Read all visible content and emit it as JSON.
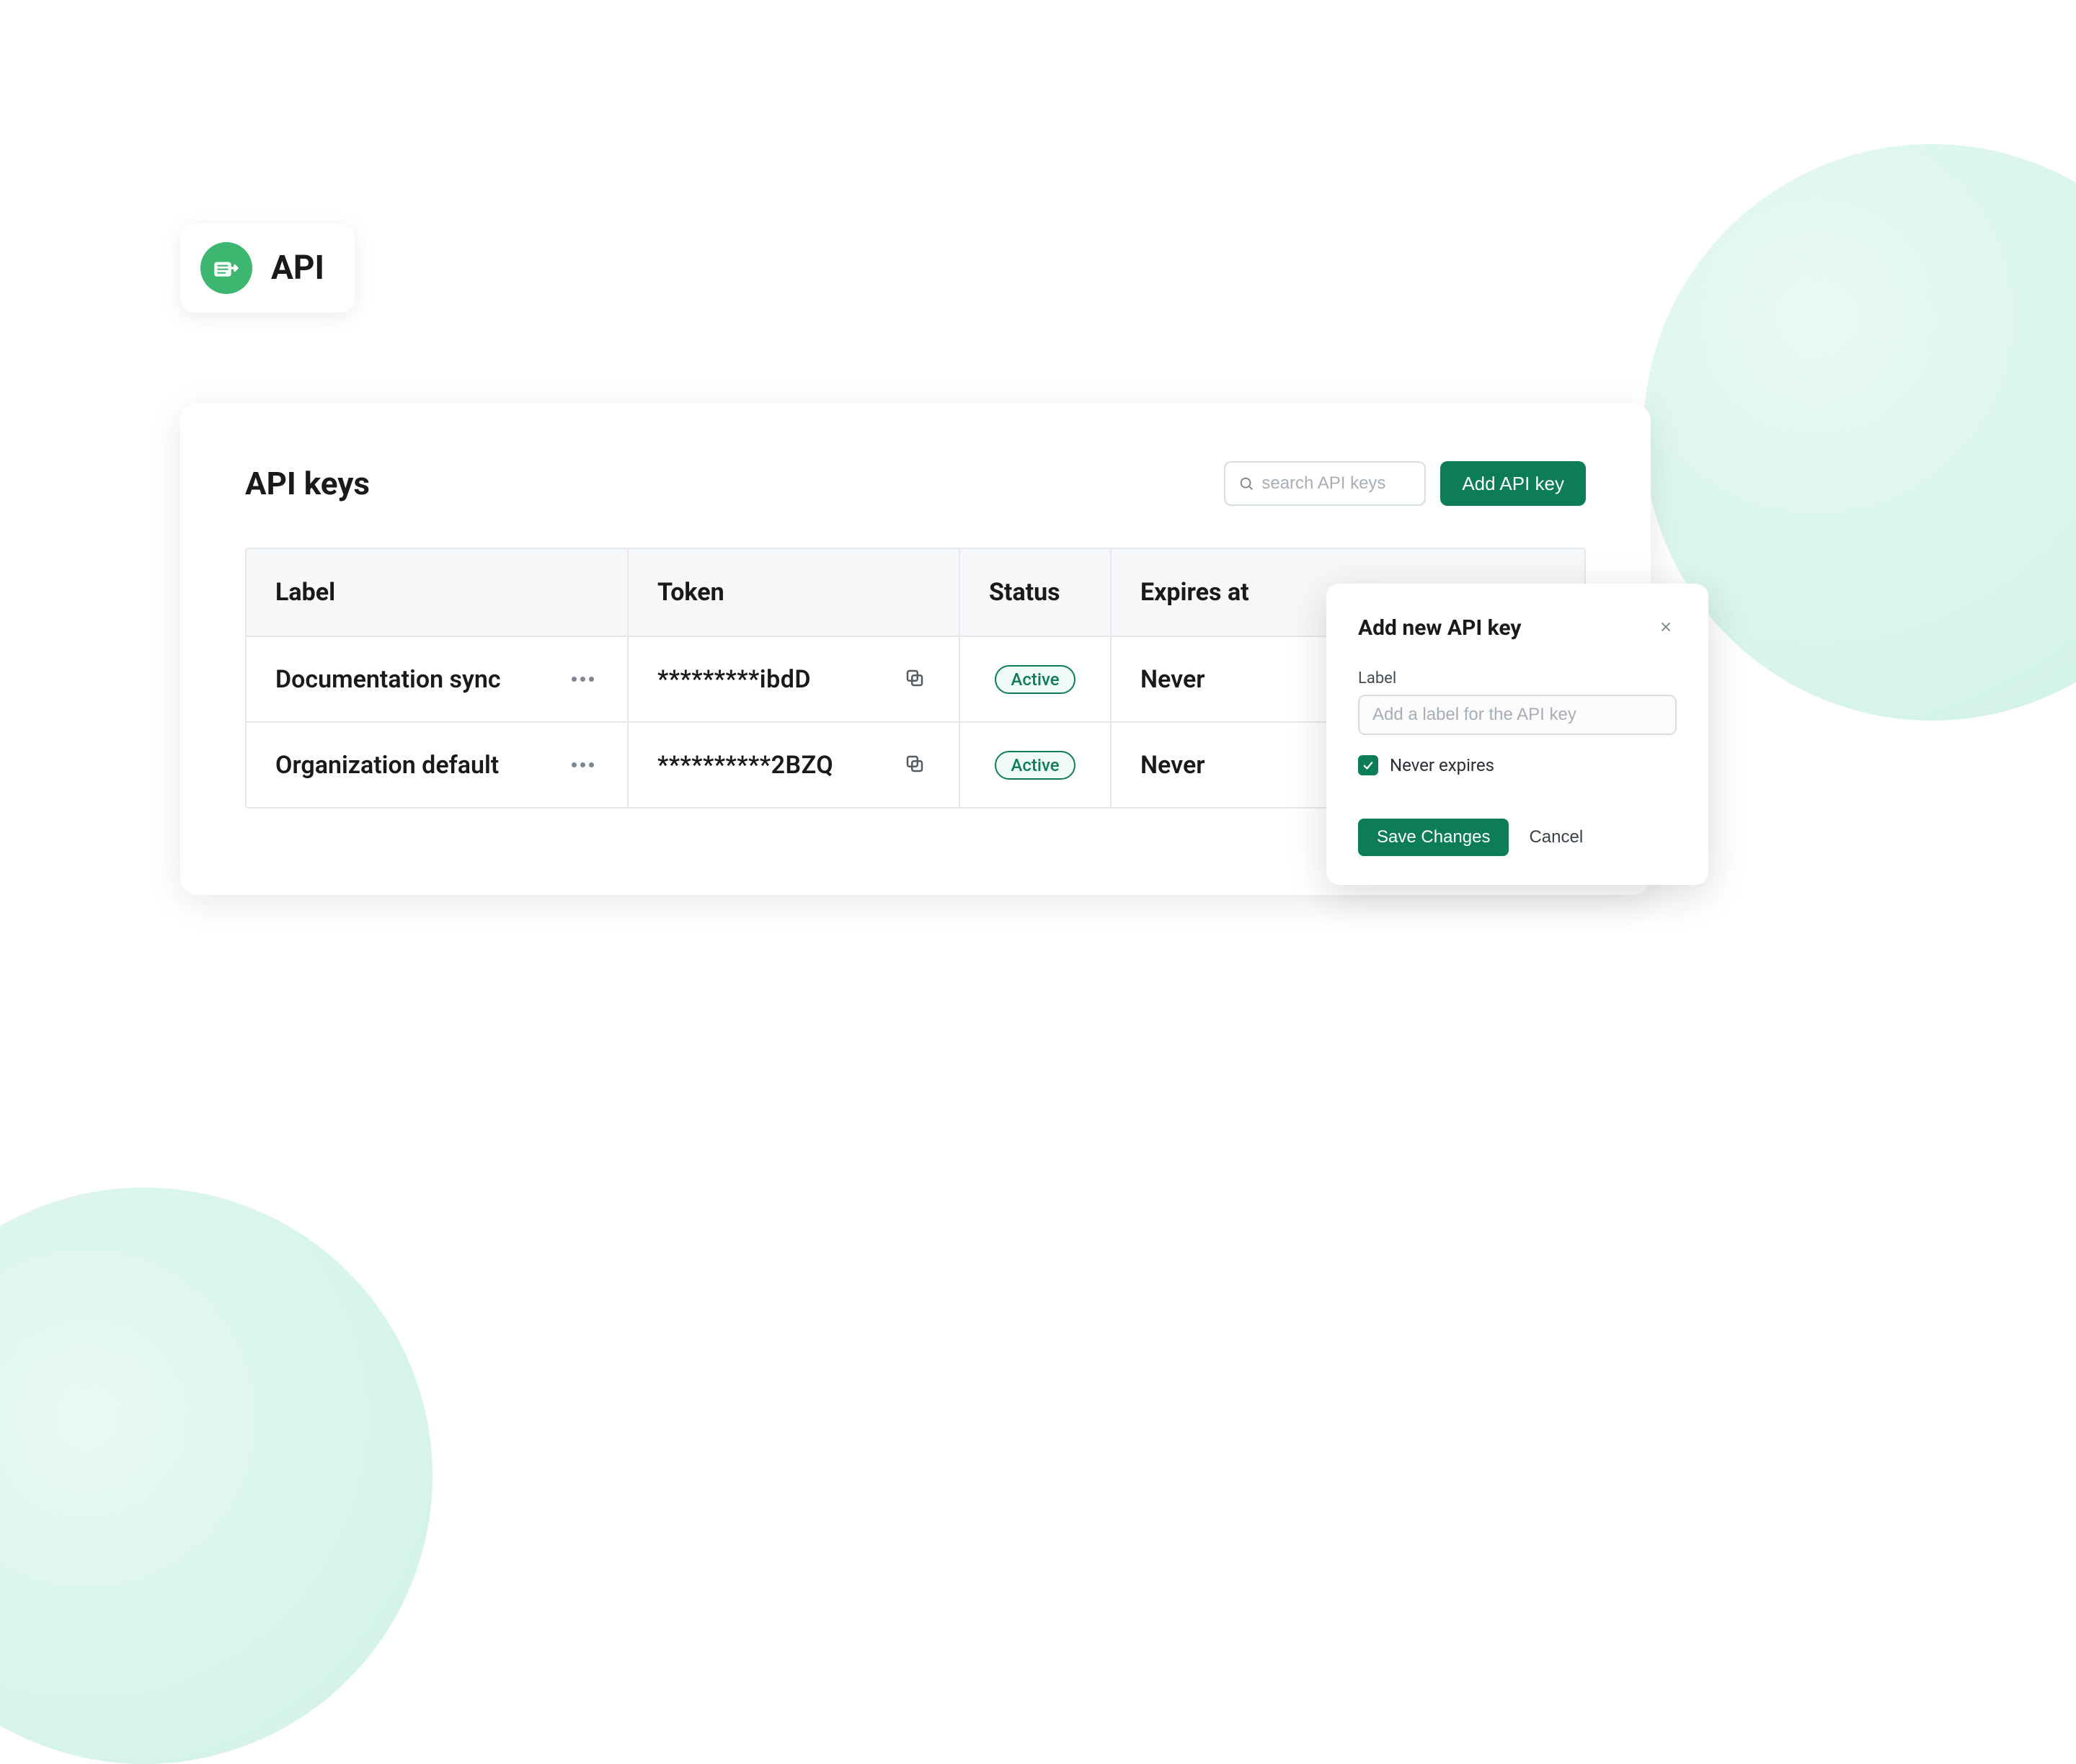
{
  "badge": {
    "title": "API"
  },
  "panel": {
    "title": "API keys",
    "search_placeholder": "search API keys",
    "add_button": "Add API key"
  },
  "table": {
    "headers": {
      "label": "Label",
      "token": "Token",
      "status": "Status",
      "expires": "Expires at"
    },
    "rows": [
      {
        "label": "Documentation sync",
        "token": "*********ibdD",
        "status": "Active",
        "expires": "Never"
      },
      {
        "label": "Organization default",
        "token": "**********2BZQ",
        "status": "Active",
        "expires": "Never"
      }
    ]
  },
  "modal": {
    "title": "Add new API key",
    "label_field": "Label",
    "label_placeholder": "Add a label for the API key",
    "never_expires": "Never expires",
    "save": "Save Changes",
    "cancel": "Cancel"
  }
}
